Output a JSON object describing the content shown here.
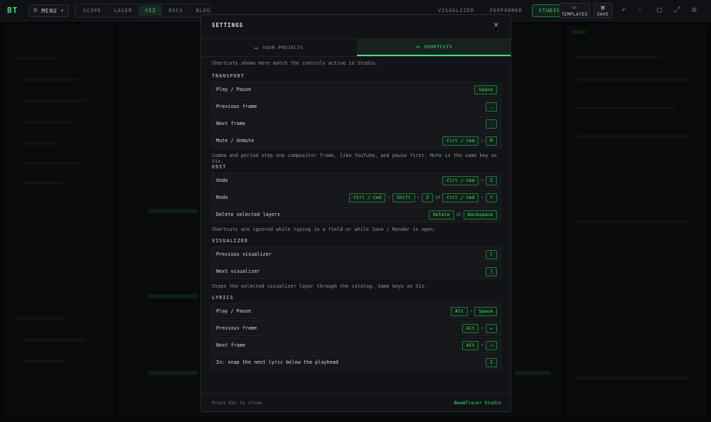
{
  "app": {
    "logo": "BT",
    "menu_label": "MENU",
    "nav_tabs": [
      {
        "label": "SCOPE",
        "active": false
      },
      {
        "label": "LASER",
        "active": false
      },
      {
        "label": "VIZ",
        "active": true
      },
      {
        "label": "DOCS",
        "active": false
      },
      {
        "label": "BLOG",
        "active": false
      }
    ],
    "mode_tabs": [
      {
        "label": "VISUALIZER",
        "active": false
      },
      {
        "label": "PERFORMER",
        "active": false
      },
      {
        "label": "STUDIO",
        "active": true
      }
    ],
    "templates_label": "TEMPLATES",
    "save_label": "SAVE"
  },
  "modal": {
    "title": "SETTINGS",
    "tabs": [
      {
        "label": "YOUR PROJECTS",
        "icon": "folder-icon",
        "active": false
      },
      {
        "label": "SHORTCUTS",
        "icon": "keyboard-icon",
        "active": true
      }
    ],
    "intro": "Shortcuts shown here match the controls active in Studio.",
    "sections": [
      {
        "heading": "TRANSPORT",
        "rows": [
          {
            "action": "Play / Pause",
            "keys": [
              "Space"
            ]
          },
          {
            "action": "Previous frame",
            "keys": [
              ","
            ]
          },
          {
            "action": "Next frame",
            "keys": [
              "."
            ]
          },
          {
            "action": "Mute / Unmute",
            "keys": [
              "Ctrl / Cmd",
              "+",
              "M"
            ]
          }
        ],
        "note": "Comma and period step one compositor frame, like YouTube, and pause first. Mute is the same key as Viz."
      },
      {
        "heading": "EDIT",
        "rows": [
          {
            "action": "Undo",
            "keys": [
              "Ctrl / Cmd",
              "+",
              "Z"
            ]
          },
          {
            "action": "Redo",
            "keys": [
              "Ctrl / Cmd",
              "+",
              "Shift",
              "+",
              "Z",
              "OR",
              "Ctrl / Cmd",
              "+",
              "Y"
            ]
          },
          {
            "action": "Delete selected layers",
            "keys": [
              "Delete",
              "OR",
              "Backspace"
            ]
          }
        ],
        "note": "Shortcuts are ignored while typing in a field or while Save / Render is open."
      },
      {
        "heading": "VISUALIZER",
        "rows": [
          {
            "action": "Previous visualizer",
            "keys": [
              "["
            ]
          },
          {
            "action": "Next visualizer",
            "keys": [
              "]"
            ]
          }
        ],
        "note": "Steps the selected visualizer layer through the catalog. Same keys as Viz."
      },
      {
        "heading": "LYRICS",
        "rows": [
          {
            "action": "Play / Pause",
            "keys": [
              "Alt",
              "+",
              "Space"
            ]
          },
          {
            "action": "Previous frame",
            "keys": [
              "Alt",
              "+",
              "←"
            ]
          },
          {
            "action": "Next frame",
            "keys": [
              "Alt",
              "+",
              "→"
            ]
          },
          {
            "action": "In: snap the next lyric below the playhead",
            "keys": [
              "I"
            ]
          }
        ],
        "note": ""
      }
    ],
    "footer_hint": "Press ESC to close",
    "footer_brand": "BeamTracer Studio"
  },
  "colors": {
    "accent": "#3ee07a",
    "background": "#0b0c0f",
    "modal": "#121317"
  }
}
